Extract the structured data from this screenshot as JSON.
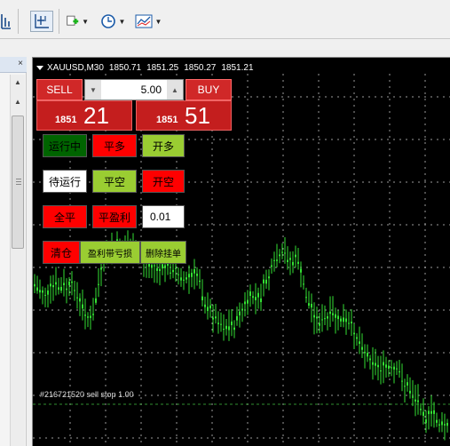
{
  "toolbar": {
    "items": [
      {
        "name": "chart-bars-icon"
      },
      {
        "name": "zoom-cursor-icon"
      },
      {
        "name": "new-order-icon"
      },
      {
        "name": "clock-icon"
      },
      {
        "name": "indicators-icon"
      }
    ]
  },
  "chart": {
    "symbol": "XAUUSD,M30",
    "prices": [
      "1850.71",
      "1851.25",
      "1850.27",
      "1851.21"
    ],
    "order_label": "#216721520 sell stop 1.00",
    "colors": {
      "background": "#000000",
      "candle": "#33e033",
      "grid": "#9a9a9a",
      "level": "#2f8f2f"
    }
  },
  "one_click": {
    "sell_label": "SELL",
    "buy_label": "BUY",
    "volume": "5.00",
    "sell_price_small": "1851",
    "sell_price_big": "21",
    "buy_price_small": "1851",
    "buy_price_big": "51"
  },
  "ea_panel": {
    "running": "运行中",
    "open_long_red": "平多",
    "open_long": "开多",
    "pending": "待运行",
    "close_short": "平空",
    "open_short": "开空",
    "close_all": "全平",
    "close_profit": "平盈利",
    "lot": "0.01",
    "clear": "清仓",
    "profit_loss": "盈利带亏损",
    "delete_pending": "删除挂单"
  }
}
